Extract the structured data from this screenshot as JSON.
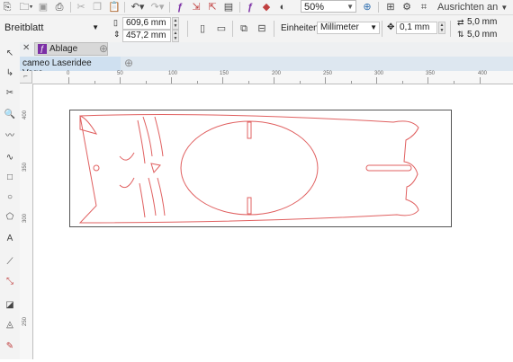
{
  "toolbar": {
    "zoom_value": "50%",
    "align_label": "Ausrichten an"
  },
  "property_bar": {
    "preset": "Breitblatt",
    "width": "609,6 mm",
    "height": "457,2 mm",
    "units_label": "Einheiten:",
    "units_value": "Millimeter",
    "nudge": "0,1 mm",
    "dup_x": "5,0 mm",
    "dup_y": "5,0 mm"
  },
  "tabs": {
    "ablage": "Ablage",
    "document": "cameo Laseridee Voge..."
  },
  "ruler": {
    "h_ticks": [
      "0",
      "50",
      "100",
      "150",
      "200",
      "250",
      "300",
      "350",
      "400"
    ],
    "v_ticks": [
      "400",
      "350",
      "300",
      "250"
    ]
  },
  "colors": {
    "cut_line": "#e06060",
    "accent": "#4f8fd0",
    "corel_purple": "#7b2fa5"
  }
}
